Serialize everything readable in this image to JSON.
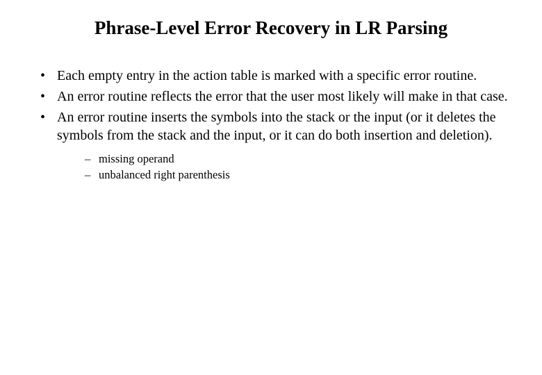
{
  "title": "Phrase-Level Error Recovery in LR Parsing",
  "bullets": [
    "Each empty entry in the action table is marked with a specific error routine.",
    "An error routine  reflects the error that the user most likely will make in that case.",
    "An error routine inserts the symbols into the stack or the input (or it deletes the symbols from the stack and the input, or it can do both insertion and deletion)."
  ],
  "subbullets": [
    "missing operand",
    "unbalanced right parenthesis"
  ]
}
